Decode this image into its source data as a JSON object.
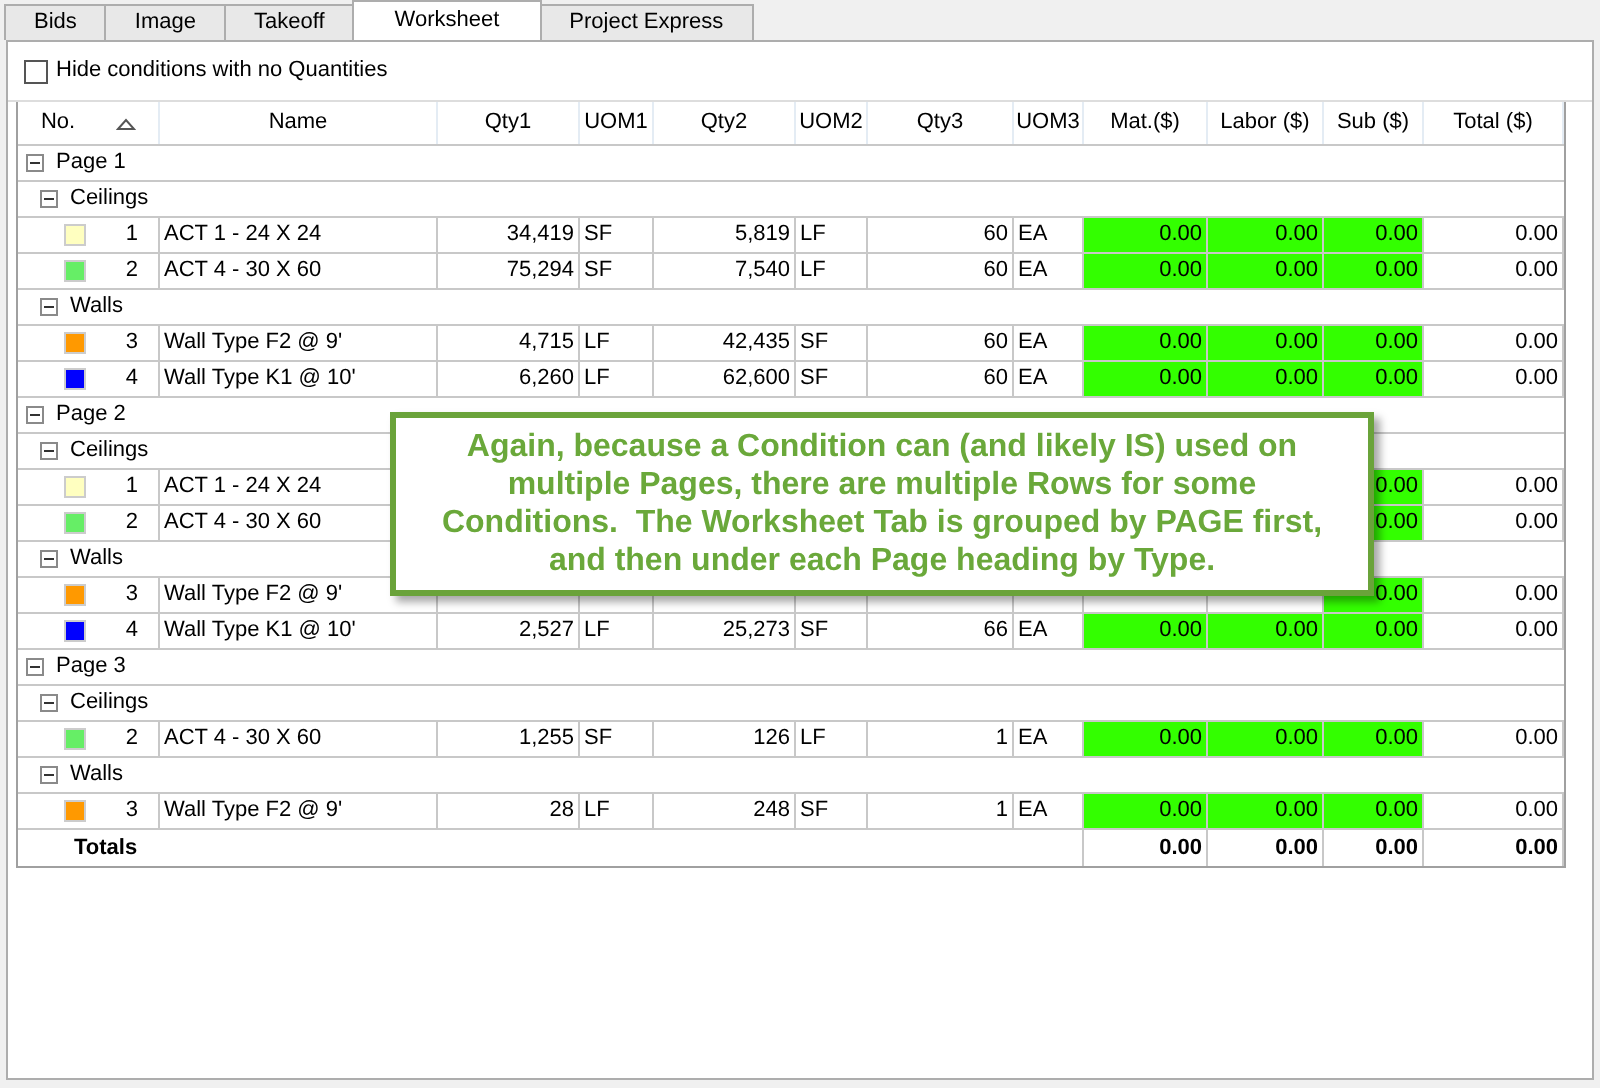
{
  "tabs": [
    {
      "label": "Bids",
      "selected": false
    },
    {
      "label": "Image",
      "selected": false
    },
    {
      "label": "Takeoff",
      "selected": false
    },
    {
      "label": "Worksheet",
      "selected": true
    },
    {
      "label": "Project Express",
      "selected": false
    }
  ],
  "hide_empty": {
    "label": "Hide conditions with no Quantities",
    "checked": false
  },
  "columns": [
    {
      "label": "No.",
      "sorted": true
    },
    {
      "label": "Name"
    },
    {
      "label": "Qty1"
    },
    {
      "label": "UOM1"
    },
    {
      "label": "Qty2"
    },
    {
      "label": "UOM2"
    },
    {
      "label": "Qty3"
    },
    {
      "label": "UOM3"
    },
    {
      "label": "Mat.($)"
    },
    {
      "label": "Labor ($)"
    },
    {
      "label": "Sub ($)"
    },
    {
      "label": "Total ($)"
    }
  ],
  "pages": [
    {
      "label": "Page 1",
      "expanded": true,
      "groups": [
        {
          "label": "Ceilings",
          "expanded": true,
          "rows": [
            {
              "no": "1",
              "color": "#ffffc0",
              "name": "ACT 1 - 24 X 24",
              "qty1": "34,419",
              "uom1": "SF",
              "qty2": "5,819",
              "uom2": "LF",
              "qty3": "60",
              "uom3": "EA",
              "mat": "0.00",
              "labor": "0.00",
              "sub": "0.00",
              "total": "0.00"
            },
            {
              "no": "2",
              "color": "#66ee66",
              "name": "ACT 4 - 30 X 60",
              "qty1": "75,294",
              "uom1": "SF",
              "qty2": "7,540",
              "uom2": "LF",
              "qty3": "60",
              "uom3": "EA",
              "mat": "0.00",
              "labor": "0.00",
              "sub": "0.00",
              "total": "0.00"
            }
          ]
        },
        {
          "label": "Walls",
          "expanded": true,
          "rows": [
            {
              "no": "3",
              "color": "#ff9900",
              "name": "Wall Type F2 @ 9'",
              "qty1": "4,715",
              "uom1": "LF",
              "qty2": "42,435",
              "uom2": "SF",
              "qty3": "60",
              "uom3": "EA",
              "mat": "0.00",
              "labor": "0.00",
              "sub": "0.00",
              "total": "0.00"
            },
            {
              "no": "4",
              "color": "#0000ff",
              "name": "Wall Type K1 @ 10'",
              "qty1": "6,260",
              "uom1": "LF",
              "qty2": "62,600",
              "uom2": "SF",
              "qty3": "60",
              "uom3": "EA",
              "mat": "0.00",
              "labor": "0.00",
              "sub": "0.00",
              "total": "0.00"
            }
          ]
        }
      ]
    },
    {
      "label": "Page 2",
      "expanded": true,
      "groups": [
        {
          "label": "Ceilings",
          "expanded": true,
          "rows": [
            {
              "no": "1",
              "color": "#ffffc0",
              "name": "ACT 1 - 24 X 24",
              "sub": "0.00",
              "total": "0.00"
            },
            {
              "no": "2",
              "color": "#66ee66",
              "name": "ACT 4 - 30 X 60",
              "sub": "0.00",
              "total": "0.00"
            }
          ]
        },
        {
          "label": "Walls",
          "expanded": true,
          "rows": [
            {
              "no": "3",
              "color": "#ff9900",
              "name": "Wall Type F2 @ 9'",
              "sub": "0.00",
              "total": "0.00"
            },
            {
              "no": "4",
              "color": "#0000ff",
              "name": "Wall Type K1 @ 10'",
              "qty1": "2,527",
              "uom1": "LF",
              "qty2": "25,273",
              "uom2": "SF",
              "qty3": "66",
              "uom3": "EA",
              "mat": "0.00",
              "labor": "0.00",
              "sub": "0.00",
              "total": "0.00"
            }
          ]
        }
      ]
    },
    {
      "label": "Page 3",
      "expanded": true,
      "groups": [
        {
          "label": "Ceilings",
          "expanded": true,
          "rows": [
            {
              "no": "2",
              "color": "#66ee66",
              "name": "ACT 4 - 30 X 60",
              "qty1": "1,255",
              "uom1": "SF",
              "qty2": "126",
              "uom2": "LF",
              "qty3": "1",
              "uom3": "EA",
              "mat": "0.00",
              "labor": "0.00",
              "sub": "0.00",
              "total": "0.00"
            }
          ]
        },
        {
          "label": "Walls",
          "expanded": true,
          "rows": [
            {
              "no": "3",
              "color": "#ff9900",
              "name": "Wall Type F2 @ 9'",
              "qty1": "28",
              "uom1": "LF",
              "qty2": "248",
              "uom2": "SF",
              "qty3": "1",
              "uom3": "EA",
              "mat": "0.00",
              "labor": "0.00",
              "sub": "0.00",
              "total": "0.00"
            }
          ]
        }
      ]
    }
  ],
  "totals": {
    "label": "Totals",
    "mat": "0.00",
    "labor": "0.00",
    "sub": "0.00",
    "total": "0.00"
  },
  "callout": {
    "text": "Again, because a Condition can (and likely IS) used on\nmultiple Pages, there are multiple Rows for some\nConditions.  The Worksheet Tab is grouped by PAGE first,\nand then under each Page heading by Type."
  }
}
